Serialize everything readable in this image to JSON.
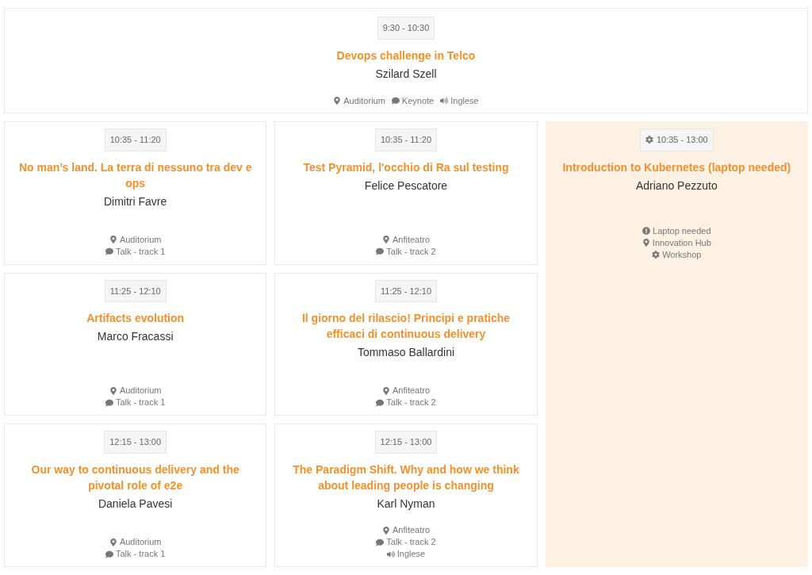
{
  "keynote": {
    "time": "9:30 - 10:30",
    "title": "Devops challenge in Telco",
    "speaker": "Szilard Szell",
    "meta": [
      {
        "kind": "location",
        "text": "Auditorium"
      },
      {
        "kind": "type",
        "text": "Keynote"
      },
      {
        "kind": "language",
        "text": "Inglese"
      }
    ]
  },
  "tracks": [
    {
      "sessions": [
        {
          "time": "10:35 - 11:20",
          "title": "No man’s land. La terra di nessuno tra dev e ops",
          "speaker": "Dimitri Favre",
          "meta": [
            {
              "kind": "location",
              "text": "Auditorium"
            },
            {
              "kind": "type",
              "text": "Talk - track 1"
            }
          ]
        },
        {
          "time": "11:25 - 12:10",
          "title": "Artifacts evolution",
          "speaker": "Marco Fracassi",
          "meta": [
            {
              "kind": "location",
              "text": "Auditorium"
            },
            {
              "kind": "type",
              "text": "Talk - track 1"
            }
          ]
        },
        {
          "time": "12:15 - 13:00",
          "title": "Our way to continuous delivery and the pivotal role of e2e",
          "speaker": "Daniela Pavesi",
          "meta": [
            {
              "kind": "location",
              "text": "Auditorium"
            },
            {
              "kind": "type",
              "text": "Talk - track 1"
            }
          ]
        }
      ]
    },
    {
      "sessions": [
        {
          "time": "10:35 - 11:20",
          "title": "Test Pyramid, l'occhio di Ra sul testing",
          "speaker": "Felice Pescatore",
          "meta": [
            {
              "kind": "location",
              "text": "Anfiteatro"
            },
            {
              "kind": "type",
              "text": "Talk - track 2"
            }
          ]
        },
        {
          "time": "11:25 - 12:10",
          "title": "Il giorno del rilascio! Principi e pratiche efficaci di continuous delivery",
          "speaker": "Tommaso Ballardini",
          "meta": [
            {
              "kind": "location",
              "text": "Anfiteatro"
            },
            {
              "kind": "type",
              "text": "Talk - track 2"
            }
          ]
        },
        {
          "time": "12:15 - 13:00",
          "title": "The Paradigm Shift. Why and how we think about leading people is changing",
          "speaker": "Karl Nyman",
          "meta": [
            {
              "kind": "location",
              "text": "Anfiteatro"
            },
            {
              "kind": "type",
              "text": "Talk - track 2"
            },
            {
              "kind": "language",
              "text": "Inglese"
            }
          ]
        }
      ]
    }
  ],
  "workshop": {
    "highlighted": true,
    "time": "10:35 - 13:00",
    "title": "Introduction to Kubernetes (laptop needed)",
    "speaker": "Adriano Pezzuto",
    "meta": [
      {
        "kind": "note",
        "text": "Laptop needed"
      },
      {
        "kind": "location",
        "text": "Innovation Hub"
      },
      {
        "kind": "workshop",
        "text": "Workshop"
      }
    ]
  }
}
